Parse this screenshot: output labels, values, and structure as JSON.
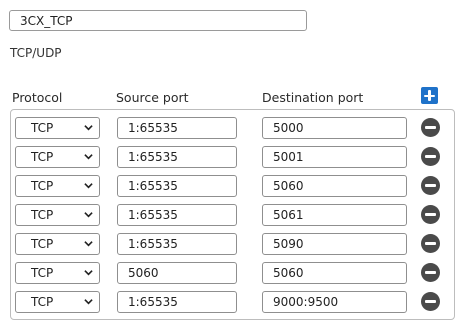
{
  "service": {
    "name_value": "3CX_TCP",
    "type_label": "TCP/UDP"
  },
  "columns": {
    "protocol": "Protocol",
    "source_port": "Source port",
    "destination_port": "Destination port"
  },
  "icons": {
    "add": "plus-icon",
    "remove": "minus-circle-icon",
    "dropdown": "chevron-down-icon"
  },
  "colors": {
    "add_button": "#1f72c9",
    "remove_button": "#4a4a4a"
  },
  "rows": [
    {
      "protocol": "TCP",
      "source": "1:65535",
      "destination": "5000"
    },
    {
      "protocol": "TCP",
      "source": "1:65535",
      "destination": "5001"
    },
    {
      "protocol": "TCP",
      "source": "1:65535",
      "destination": "5060"
    },
    {
      "protocol": "TCP",
      "source": "1:65535",
      "destination": "5061"
    },
    {
      "protocol": "TCP",
      "source": "1:65535",
      "destination": "5090"
    },
    {
      "protocol": "TCP",
      "source": "5060",
      "destination": "5060"
    },
    {
      "protocol": "TCP",
      "source": "1:65535",
      "destination": "9000:9500"
    }
  ]
}
